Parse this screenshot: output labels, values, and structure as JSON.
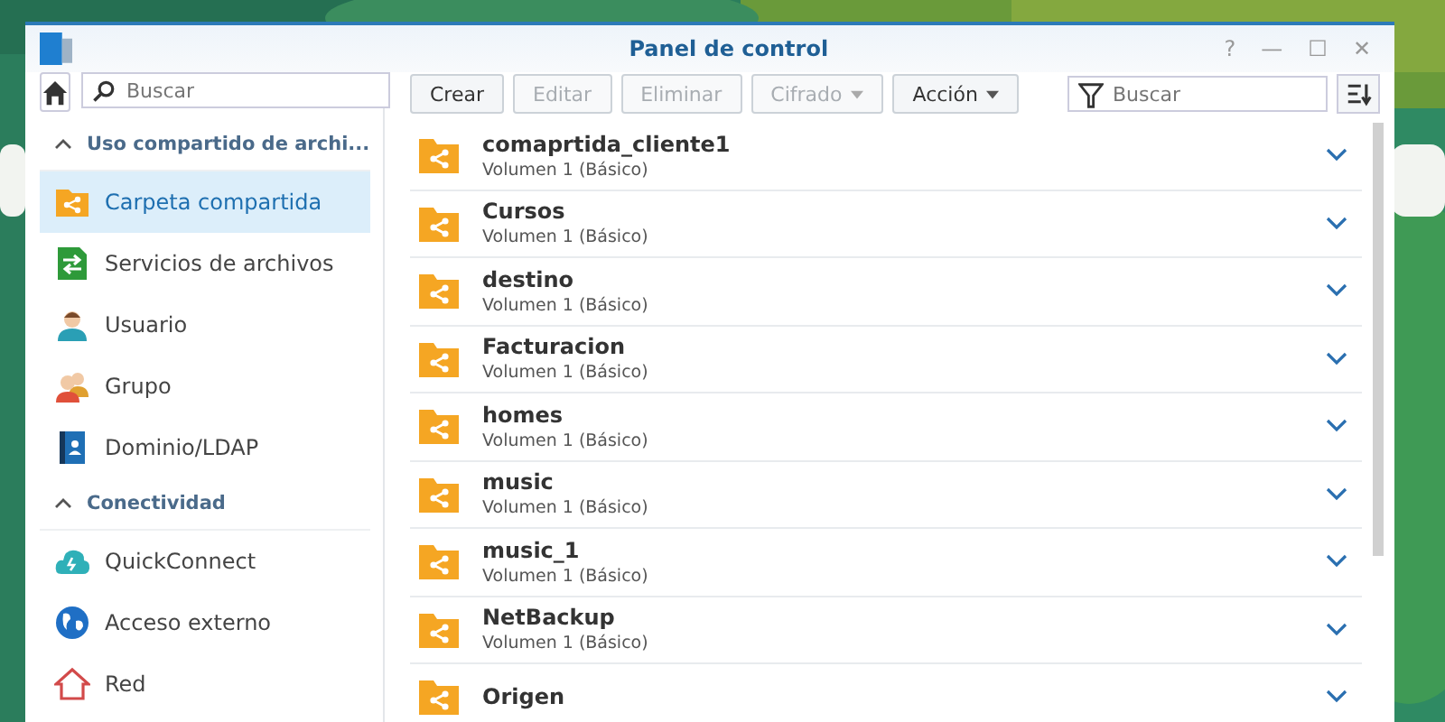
{
  "window": {
    "title": "Panel de control",
    "controls": [
      "?",
      "—",
      "☐",
      "✕"
    ]
  },
  "sidebar": {
    "search": {
      "placeholder": "Buscar"
    },
    "sections": [
      {
        "label": "Uso compartido de archi...",
        "expanded": true,
        "items": [
          {
            "label": "Carpeta compartida",
            "selected": true
          },
          {
            "label": "Servicios de archivos",
            "selected": false
          },
          {
            "label": "Usuario",
            "selected": false
          },
          {
            "label": "Grupo",
            "selected": false
          },
          {
            "label": "Dominio/LDAP",
            "selected": false
          }
        ]
      },
      {
        "label": "Conectividad",
        "expanded": true,
        "items": [
          {
            "label": "QuickConnect",
            "selected": false
          },
          {
            "label": "Acceso externo",
            "selected": false
          },
          {
            "label": "Red",
            "selected": false
          }
        ]
      }
    ]
  },
  "toolbar": {
    "buttons": [
      {
        "label": "Crear",
        "kind": "button",
        "disabled": false
      },
      {
        "label": "Editar",
        "kind": "button",
        "disabled": true
      },
      {
        "label": "Eliminar",
        "kind": "button",
        "disabled": true
      },
      {
        "label": "Cifrado",
        "kind": "menu",
        "disabled": true
      },
      {
        "label": "Acción",
        "kind": "menu",
        "disabled": false
      }
    ],
    "filter": {
      "placeholder": "Buscar"
    }
  },
  "folders": [
    {
      "name": "comaprtida_cliente1",
      "volume": "Volumen 1 (Básico)",
      "expanded": false
    },
    {
      "name": "Cursos",
      "volume": "Volumen 1 (Básico)",
      "expanded": false
    },
    {
      "name": "destino",
      "volume": "Volumen 1 (Básico)",
      "expanded": false
    },
    {
      "name": "Facturacion",
      "volume": "Volumen 1 (Básico)",
      "expanded": false
    },
    {
      "name": "homes",
      "volume": "Volumen 1 (Básico)",
      "expanded": false
    },
    {
      "name": "music",
      "volume": "Volumen 1 (Básico)",
      "expanded": false
    },
    {
      "name": "music_1",
      "volume": "Volumen 1 (Básico)",
      "expanded": false
    },
    {
      "name": "NetBackup",
      "volume": "Volumen 1 (Básico)",
      "expanded": false
    },
    {
      "name": "Origen",
      "expanded": false
    }
  ]
}
